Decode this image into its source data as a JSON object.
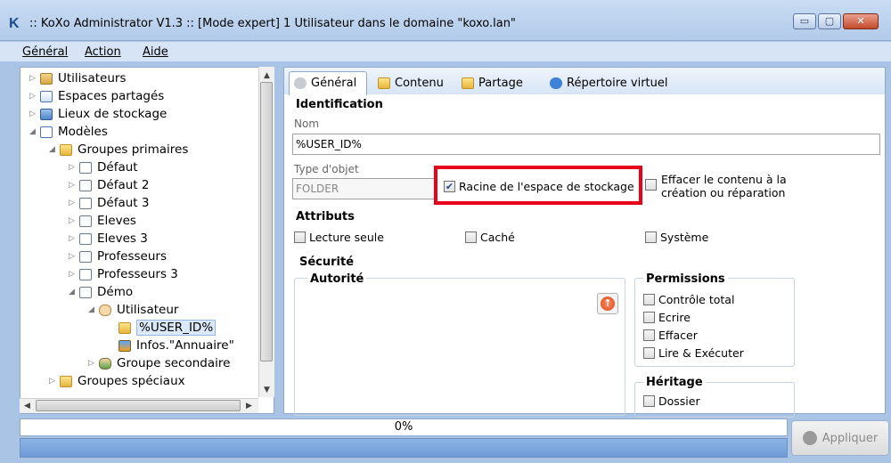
{
  "window": {
    "title": ":: KoXo Administrator V1.3 :: [Mode expert] 1 Utilisateur dans le domaine \"koxo.lan\"",
    "logo": "K",
    "controls": {
      "minimize": "▭",
      "maximize": "▢",
      "close": "✕"
    }
  },
  "menu": [
    {
      "label": "Général"
    },
    {
      "label": "Action"
    },
    {
      "label": "Aide"
    }
  ],
  "tree": [
    {
      "label": "Utilisateurs",
      "indent": 0,
      "toggle": "▷",
      "icon": "users-icon"
    },
    {
      "label": "Espaces partagés",
      "indent": 0,
      "toggle": "▷",
      "icon": "shared-spaces-icon"
    },
    {
      "label": "Lieux de stockage",
      "indent": 0,
      "toggle": "▷",
      "icon": "storage-icon"
    },
    {
      "label": "Modèles",
      "indent": 0,
      "toggle": "◢",
      "icon": "templates-icon"
    },
    {
      "label": "Groupes primaires",
      "indent": 1,
      "toggle": "◢",
      "icon": "folder-icon"
    },
    {
      "label": "Défaut",
      "indent": 2,
      "toggle": "▷",
      "icon": "document-icon"
    },
    {
      "label": "Défaut 2",
      "indent": 2,
      "toggle": "▷",
      "icon": "document-icon"
    },
    {
      "label": "Défaut 3",
      "indent": 2,
      "toggle": "▷",
      "icon": "document-icon"
    },
    {
      "label": "Eleves",
      "indent": 2,
      "toggle": "▷",
      "icon": "document-icon"
    },
    {
      "label": "Eleves 3",
      "indent": 2,
      "toggle": "▷",
      "icon": "document-icon"
    },
    {
      "label": "Professeurs",
      "indent": 2,
      "toggle": "▷",
      "icon": "document-icon"
    },
    {
      "label": "Professeurs 3",
      "indent": 2,
      "toggle": "▷",
      "icon": "document-icon"
    },
    {
      "label": "Démo",
      "indent": 2,
      "toggle": "◢",
      "icon": "document-icon"
    },
    {
      "label": "Utilisateur",
      "indent": 3,
      "toggle": "◢",
      "icon": "user-icon"
    },
    {
      "label": "%USER_ID%",
      "indent": 4,
      "toggle": "",
      "icon": "folder-icon",
      "selected": true
    },
    {
      "label": "Infos.\"Annuaire\"",
      "indent": 4,
      "toggle": "",
      "icon": "info-icon"
    },
    {
      "label": "Groupe secondaire",
      "indent": 3,
      "toggle": "▷",
      "icon": "group-icon"
    },
    {
      "label": "Groupes spéciaux",
      "indent": 1,
      "toggle": "▷",
      "icon": "folder-icon"
    }
  ],
  "tabs": [
    "Général",
    "Contenu",
    "Partage",
    "Répertoire virtuel"
  ],
  "identification": {
    "heading": "Identification",
    "name_label": "Nom",
    "name_value": "%USER_ID%",
    "type_label": "Type d'objet",
    "type_value": "FOLDER",
    "root_checkbox": "Racine de l'espace de stockage",
    "root_checked": true,
    "erase_line1": "Effacer le contenu à la",
    "erase_line2": "création ou réparation"
  },
  "attributes": {
    "heading": "Attributs",
    "read_only": "Lecture seule",
    "hidden": "Caché",
    "system": "Système"
  },
  "security": {
    "heading": "Sécurité",
    "authority": "Autorité",
    "permissions": "Permissions",
    "perm_items": [
      "Contrôle total",
      "Ecrire",
      "Effacer",
      "Lire & Exécuter"
    ],
    "inheritance": "Héritage",
    "inherit_items": [
      "Dossier"
    ]
  },
  "footer": {
    "progress": "0%",
    "progress_fraction": 0,
    "apply": "Appliquer"
  },
  "colors": {
    "highlight": "#e8001b",
    "status_bar": "#7ea6dc"
  }
}
